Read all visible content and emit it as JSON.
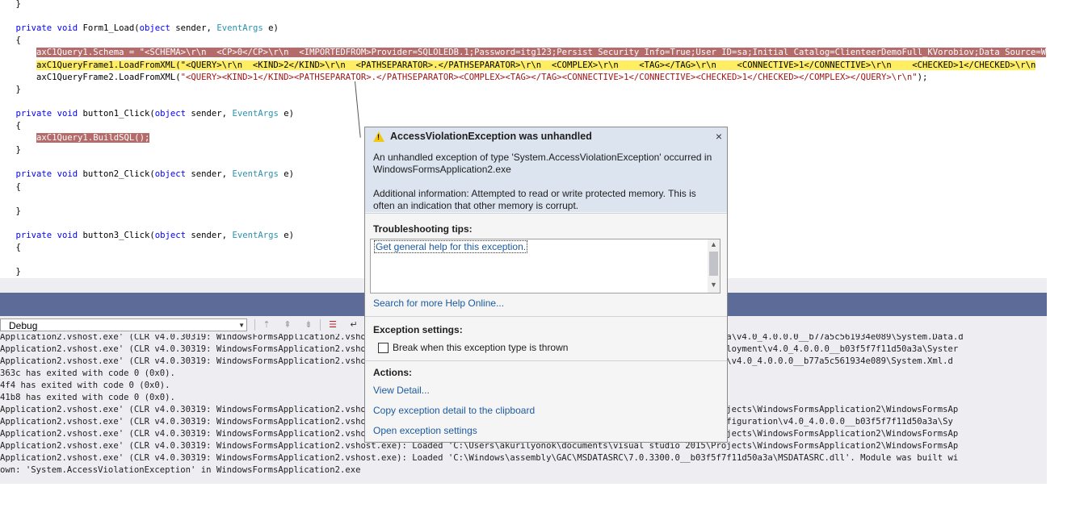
{
  "editor": {
    "lines": [
      {
        "text": "    }"
      },
      {
        "text": ""
      },
      {
        "pre": "    ",
        "kw1": "private",
        "kw2": "void",
        "name": " Form1_Load(",
        "kw3": "object",
        "mid": " sender, ",
        "ty": "EventArgs",
        "post": " e)"
      },
      {
        "text": "    {"
      },
      {
        "hl": "        axC1Query1.Schema = \"<SCHEMA>\\r\\n  <CP>0</CP>\\r\\n  <IMPORTEDFROM>Provider=SQLOLEDB.1;Password=itg123;Persist Security Info=True;User ID=sa;Initial Catalog=ClienteerDemoFull_KVorobiov;Data Source=W"
      },
      {
        "yel": "        axC1QueryFrame1.LoadFromXML(\"<QUERY>\\r\\n  <KIND>2</KIND>\\r\\n  <PATHSEPARATOR>.</PATHSEPARATOR>\\r\\n  <COMPLEX>\\r\\n    <TAG></TAG>\\r\\n    <CONNECTIVE>1</CONNECTIVE>\\r\\n    <CHECKED>1</CHECKED>\\r\\n"
      },
      {
        "pre": "        axC1QueryFrame2.LoadFromXML(",
        "str": "\"<QUERY><KIND>1</KIND><PATHSEPARATOR>.</PATHSEPARATOR><COMPLEX><TAG></TAG><CONNECTIVE>1</CONNECTIVE><CHECKED>1</CHECKED></COMPLEX></QUERY>\\r\\n\"",
        "post": ");"
      },
      {
        "text": "    }"
      },
      {
        "text": ""
      },
      {
        "pre": "    ",
        "kw1": "private",
        "kw2": "void",
        "name": " button1_Click(",
        "kw3": "object",
        "mid": " sender, ",
        "ty": "EventArgs",
        "post": " e)"
      },
      {
        "text": "    {"
      },
      {
        "hl_short": "        ",
        "hl_text": "axC1Query1.BuildSQL();"
      },
      {
        "text": "    }"
      },
      {
        "text": ""
      },
      {
        "pre": "    ",
        "kw1": "private",
        "kw2": "void",
        "name": " button2_Click(",
        "kw3": "object",
        "mid": " sender, ",
        "ty": "EventArgs",
        "post": " e)"
      },
      {
        "text": "    {"
      },
      {
        "text": ""
      },
      {
        "text": "    }"
      },
      {
        "text": ""
      },
      {
        "pre": "    ",
        "kw1": "private",
        "kw2": "void",
        "name": " button3_Click(",
        "kw3": "object",
        "mid": " sender, ",
        "ty": "EventArgs",
        "post": " e)"
      },
      {
        "text": "    {"
      },
      {
        "text": ""
      },
      {
        "text": "    }"
      }
    ]
  },
  "output": {
    "source_combo": "Debug",
    "lines": [
      "Application2.vshost.exe' (CLR v4.0.30319: WindowsFormsApplication2.vshost.exe): Loaded 'C:\\Windows\\Microsoft.Net\\assembly\\GAC_MSIL\\System.Data\\v4.0_4.0.0.0__b77a5c561934e089\\System.Data.d",
      "Application2.vshost.exe' (CLR v4.0.30319: WindowsFormsApplication2.vshost.exe): Loaded 'C:\\Windows\\Microsoft.Net\\assembly\\GAC_MSIL\\System.Deployment\\v4.0_4.0.0.0__b03f5f7f11d50a3a\\Syster",
      "Application2.vshost.exe' (CLR v4.0.30319: WindowsFormsApplication2.vshost.exe): Loaded 'C:\\Windows\\Microsoft.Net\\assembly\\GAC_MSIL\\System.Xml\\v4.0_4.0.0.0__b77a5c561934e089\\System.Xml.d",
      "363c has exited with code 0 (0x0).",
      "4f4 has exited with code 0 (0x0).",
      "41b8 has exited with code 0 (0x0).",
      "Application2.vshost.exe' (CLR v4.0.30319: WindowsFormsApplication2.vshost.exe): Loaded 'C:\\Users\\akurilyonok\\documents\\visual studio 2015\\Projects\\WindowsFormsApplication2\\WindowsFormsAp",
      "Application2.vshost.exe' (CLR v4.0.30319: WindowsFormsApplication2.vshost.exe): Loaded 'C:\\Windows\\Microsoft.Net\\assembly\\GAC_MSIL\\System.Configuration\\v4.0_4.0.0.0__b03f5f7f11d50a3a\\Sy",
      "Application2.vshost.exe' (CLR v4.0.30319: WindowsFormsApplication2.vshost.exe): Loaded 'C:\\Users\\akurilyonok\\documents\\visual studio 2015\\Projects\\WindowsFormsApplication2\\WindowsFormsAp",
      "Application2.vshost.exe' (CLR v4.0.30319: WindowsFormsApplication2.vshost.exe): Loaded 'C:\\Users\\akurilyonok\\documents\\visual studio 2015\\Projects\\WindowsFormsApplication2\\WindowsFormsAp",
      "Application2.vshost.exe' (CLR v4.0.30319: WindowsFormsApplication2.vshost.exe): Loaded 'C:\\Windows\\assembly\\GAC\\MSDATASRC\\7.0.3300.0__b03f5f7f11d50a3a\\MSDATASRC.dll'. Module was built wi",
      "own: 'System.AccessViolationException' in WindowsFormsApplication2.exe"
    ]
  },
  "dialog": {
    "title": "AccessViolationException was unhandled",
    "close_glyph": "×",
    "message1_line1": "An unhandled exception of type 'System.AccessViolationException' occurred in",
    "message1_line2": "WindowsFormsApplication2.exe",
    "message2_line1": "Additional information: Attempted to read or write protected memory. This is",
    "message2_line2": "often an indication that other memory is corrupt.",
    "troubleshooting_heading": "Troubleshooting tips:",
    "tip_link": "Get general help for this exception.",
    "search_link": "Search for more Help Online...",
    "exception_settings_heading": "Exception settings:",
    "break_checkbox_label": "Break when this exception type is thrown",
    "break_checked": false,
    "actions_heading": "Actions:",
    "action_view_detail": "View Detail...",
    "action_copy": "Copy exception detail to the clipboard",
    "action_open_settings": "Open exception settings"
  },
  "icons": [
    "warning-icon",
    "close-icon",
    "dropdown-arrow-icon",
    "scroll-up-icon",
    "scroll-down-icon",
    "clear-all-icon",
    "word-wrap-icon"
  ]
}
